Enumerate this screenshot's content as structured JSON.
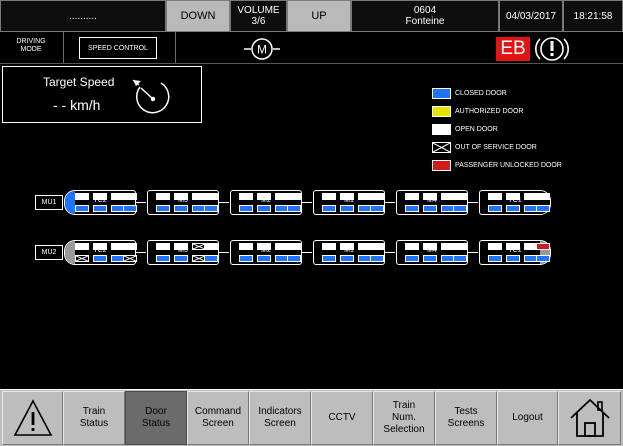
{
  "topbar": {
    "msg": "..........",
    "down": "DOWN",
    "volume_label": "VOLUME",
    "volume_value": "3/6",
    "up": "UP",
    "station_code": "0604",
    "station_name": "Fonteine",
    "date": "04/03/2017",
    "time": "18:21:58"
  },
  "bar2": {
    "driving_mode": "DRIVING MODE",
    "speed_control": "SPEED CONTROL",
    "eb": "EB"
  },
  "target_speed": {
    "title": "Target Speed",
    "value": "- - km/h"
  },
  "legend": [
    {
      "key": "closed",
      "label": "CLOSED DOOR",
      "color": "#1f74ff"
    },
    {
      "key": "authorized",
      "label": "AUTHORIZED DOOR",
      "color": "#e4e400"
    },
    {
      "key": "open",
      "label": "OPEN DOOR",
      "color": "#ffffff"
    },
    {
      "key": "oos",
      "label": "OUT OF SERVICE DOOR",
      "color": "#000000"
    },
    {
      "key": "unlocked",
      "label": "PASSENGER UNLOCKED DOOR",
      "color": "#d11a1a"
    }
  ],
  "trains": [
    {
      "label": "MU1",
      "cars": [
        {
          "name": "TC2",
          "top": [
            "open",
            "open",
            "open",
            "open"
          ],
          "bottom": [
            "closed",
            "closed",
            "closed",
            "closed"
          ]
        },
        {
          "name": "M3",
          "top": [
            "open",
            "open",
            "open",
            "open"
          ],
          "bottom": [
            "closed",
            "closed",
            "closed",
            "closed"
          ]
        },
        {
          "name": "M2",
          "top": [
            "open",
            "open",
            "open",
            "open"
          ],
          "bottom": [
            "closed",
            "closed",
            "closed",
            "closed"
          ]
        },
        {
          "name": "M1",
          "top": [
            "open",
            "open",
            "open",
            "open"
          ],
          "bottom": [
            "closed",
            "closed",
            "closed",
            "closed"
          ]
        },
        {
          "name": "M4",
          "top": [
            "open",
            "open",
            "open",
            "open"
          ],
          "bottom": [
            "closed",
            "closed",
            "closed",
            "closed"
          ]
        },
        {
          "name": "TC1",
          "top": [
            "open",
            "open",
            "open",
            "open"
          ],
          "bottom": [
            "closed",
            "closed",
            "closed",
            "closed"
          ]
        }
      ]
    },
    {
      "label": "MU2",
      "cars": [
        {
          "name": "TC2",
          "top": [
            "open",
            "open",
            "open",
            "open"
          ],
          "bottom": [
            "oos",
            "closed",
            "closed",
            "oos"
          ]
        },
        {
          "name": "M3",
          "top": [
            "open",
            "open",
            "oos",
            "open"
          ],
          "bottom": [
            "closed",
            "closed",
            "oos",
            "closed"
          ]
        },
        {
          "name": "M2",
          "top": [
            "open",
            "open",
            "open",
            "open"
          ],
          "bottom": [
            "closed",
            "closed",
            "closed",
            "closed"
          ]
        },
        {
          "name": "M1",
          "top": [
            "open",
            "open",
            "open",
            "open"
          ],
          "bottom": [
            "closed",
            "closed",
            "closed",
            "closed"
          ]
        },
        {
          "name": "M4",
          "top": [
            "open",
            "open",
            "open",
            "open"
          ],
          "bottom": [
            "closed",
            "closed",
            "closed",
            "closed"
          ]
        },
        {
          "name": "TC1",
          "top": [
            "open",
            "open",
            "open",
            "unlocked"
          ],
          "bottom": [
            "closed",
            "closed",
            "closed",
            "closed"
          ]
        }
      ]
    }
  ],
  "nav": {
    "warning": "warning-icon",
    "train_status": "Train\nStatus",
    "door_status": "Door\nStatus",
    "command_screen": "Command\nScreen",
    "indicators_screen": "Indicators\nScreen",
    "cctv": "CCTV",
    "train_num_selection": "Train\nNum.\nSelection",
    "tests_screens": "Tests\nScreens",
    "logout": "Logout",
    "home": "home-icon"
  }
}
